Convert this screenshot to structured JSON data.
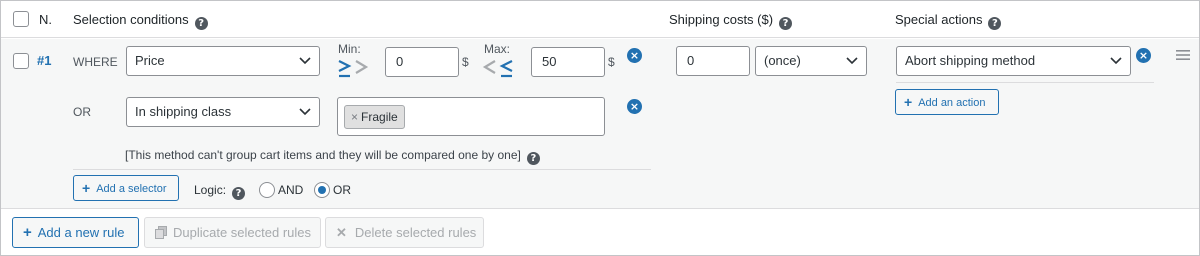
{
  "header": {
    "number_label": "N.",
    "selection_conditions": "Selection conditions",
    "shipping_costs": "Shipping costs ($)",
    "special_actions": "Special actions"
  },
  "rule": {
    "number": "#1",
    "where_label": "WHERE",
    "condition_select": "Price",
    "min_label": "Min:",
    "min_value": "0",
    "currency": "$",
    "max_label": "Max:",
    "max_value": "50",
    "or_label": "OR",
    "shipping_class_select": "In shipping class",
    "tag": "Fragile",
    "tag_remove": "×",
    "note": "[This method can't group cart items and they will be compared one by one]",
    "add_selector": "Add a selector",
    "logic_label": "Logic:",
    "logic_and": "AND",
    "logic_or": "OR",
    "logic_selected": "OR",
    "cost_value": "0",
    "cost_frequency": "(once)",
    "action_select": "Abort shipping method",
    "add_action": "Add an action"
  },
  "footer": {
    "add_rule": "Add a new rule",
    "duplicate": "Duplicate selected rules",
    "delete": "Delete selected rules"
  },
  "colors": {
    "accent": "#2271b1",
    "border": "#8c8f94",
    "row_bg": "#f6f7f7",
    "disabled": "#a7aaad"
  },
  "icons": {
    "help": "question-circle-icon",
    "remove": "close-circle-icon",
    "drag": "hamburger-icon",
    "plus": "plus-icon",
    "duplicate": "copy-icon",
    "delete": "x-icon"
  }
}
